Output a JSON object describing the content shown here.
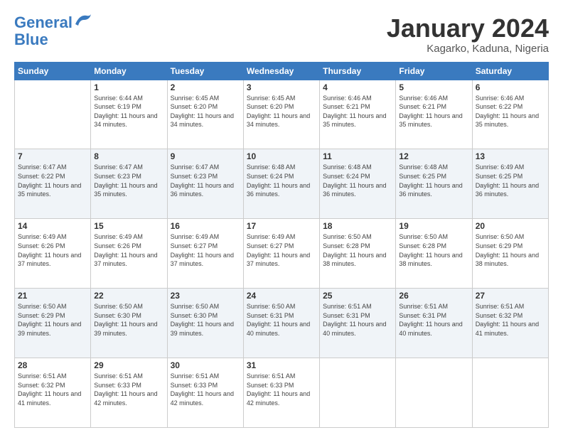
{
  "logo": {
    "line1": "General",
    "line2": "Blue"
  },
  "title": "January 2024",
  "subtitle": "Kagarko, Kaduna, Nigeria",
  "days_of_week": [
    "Sunday",
    "Monday",
    "Tuesday",
    "Wednesday",
    "Thursday",
    "Friday",
    "Saturday"
  ],
  "weeks": [
    [
      {
        "day": "",
        "sunrise": "",
        "sunset": "",
        "daylight": ""
      },
      {
        "day": "1",
        "sunrise": "6:44 AM",
        "sunset": "6:19 PM",
        "daylight": "11 hours and 34 minutes."
      },
      {
        "day": "2",
        "sunrise": "6:45 AM",
        "sunset": "6:20 PM",
        "daylight": "11 hours and 34 minutes."
      },
      {
        "day": "3",
        "sunrise": "6:45 AM",
        "sunset": "6:20 PM",
        "daylight": "11 hours and 34 minutes."
      },
      {
        "day": "4",
        "sunrise": "6:46 AM",
        "sunset": "6:21 PM",
        "daylight": "11 hours and 35 minutes."
      },
      {
        "day": "5",
        "sunrise": "6:46 AM",
        "sunset": "6:21 PM",
        "daylight": "11 hours and 35 minutes."
      },
      {
        "day": "6",
        "sunrise": "6:46 AM",
        "sunset": "6:22 PM",
        "daylight": "11 hours and 35 minutes."
      }
    ],
    [
      {
        "day": "7",
        "sunrise": "6:47 AM",
        "sunset": "6:22 PM",
        "daylight": "11 hours and 35 minutes."
      },
      {
        "day": "8",
        "sunrise": "6:47 AM",
        "sunset": "6:23 PM",
        "daylight": "11 hours and 35 minutes."
      },
      {
        "day": "9",
        "sunrise": "6:47 AM",
        "sunset": "6:23 PM",
        "daylight": "11 hours and 36 minutes."
      },
      {
        "day": "10",
        "sunrise": "6:48 AM",
        "sunset": "6:24 PM",
        "daylight": "11 hours and 36 minutes."
      },
      {
        "day": "11",
        "sunrise": "6:48 AM",
        "sunset": "6:24 PM",
        "daylight": "11 hours and 36 minutes."
      },
      {
        "day": "12",
        "sunrise": "6:48 AM",
        "sunset": "6:25 PM",
        "daylight": "11 hours and 36 minutes."
      },
      {
        "day": "13",
        "sunrise": "6:49 AM",
        "sunset": "6:25 PM",
        "daylight": "11 hours and 36 minutes."
      }
    ],
    [
      {
        "day": "14",
        "sunrise": "6:49 AM",
        "sunset": "6:26 PM",
        "daylight": "11 hours and 37 minutes."
      },
      {
        "day": "15",
        "sunrise": "6:49 AM",
        "sunset": "6:26 PM",
        "daylight": "11 hours and 37 minutes."
      },
      {
        "day": "16",
        "sunrise": "6:49 AM",
        "sunset": "6:27 PM",
        "daylight": "11 hours and 37 minutes."
      },
      {
        "day": "17",
        "sunrise": "6:49 AM",
        "sunset": "6:27 PM",
        "daylight": "11 hours and 37 minutes."
      },
      {
        "day": "18",
        "sunrise": "6:50 AM",
        "sunset": "6:28 PM",
        "daylight": "11 hours and 38 minutes."
      },
      {
        "day": "19",
        "sunrise": "6:50 AM",
        "sunset": "6:28 PM",
        "daylight": "11 hours and 38 minutes."
      },
      {
        "day": "20",
        "sunrise": "6:50 AM",
        "sunset": "6:29 PM",
        "daylight": "11 hours and 38 minutes."
      }
    ],
    [
      {
        "day": "21",
        "sunrise": "6:50 AM",
        "sunset": "6:29 PM",
        "daylight": "11 hours and 39 minutes."
      },
      {
        "day": "22",
        "sunrise": "6:50 AM",
        "sunset": "6:30 PM",
        "daylight": "11 hours and 39 minutes."
      },
      {
        "day": "23",
        "sunrise": "6:50 AM",
        "sunset": "6:30 PM",
        "daylight": "11 hours and 39 minutes."
      },
      {
        "day": "24",
        "sunrise": "6:50 AM",
        "sunset": "6:31 PM",
        "daylight": "11 hours and 40 minutes."
      },
      {
        "day": "25",
        "sunrise": "6:51 AM",
        "sunset": "6:31 PM",
        "daylight": "11 hours and 40 minutes."
      },
      {
        "day": "26",
        "sunrise": "6:51 AM",
        "sunset": "6:31 PM",
        "daylight": "11 hours and 40 minutes."
      },
      {
        "day": "27",
        "sunrise": "6:51 AM",
        "sunset": "6:32 PM",
        "daylight": "11 hours and 41 minutes."
      }
    ],
    [
      {
        "day": "28",
        "sunrise": "6:51 AM",
        "sunset": "6:32 PM",
        "daylight": "11 hours and 41 minutes."
      },
      {
        "day": "29",
        "sunrise": "6:51 AM",
        "sunset": "6:33 PM",
        "daylight": "11 hours and 42 minutes."
      },
      {
        "day": "30",
        "sunrise": "6:51 AM",
        "sunset": "6:33 PM",
        "daylight": "11 hours and 42 minutes."
      },
      {
        "day": "31",
        "sunrise": "6:51 AM",
        "sunset": "6:33 PM",
        "daylight": "11 hours and 42 minutes."
      },
      {
        "day": "",
        "sunrise": "",
        "sunset": "",
        "daylight": ""
      },
      {
        "day": "",
        "sunrise": "",
        "sunset": "",
        "daylight": ""
      },
      {
        "day": "",
        "sunrise": "",
        "sunset": "",
        "daylight": ""
      }
    ]
  ]
}
